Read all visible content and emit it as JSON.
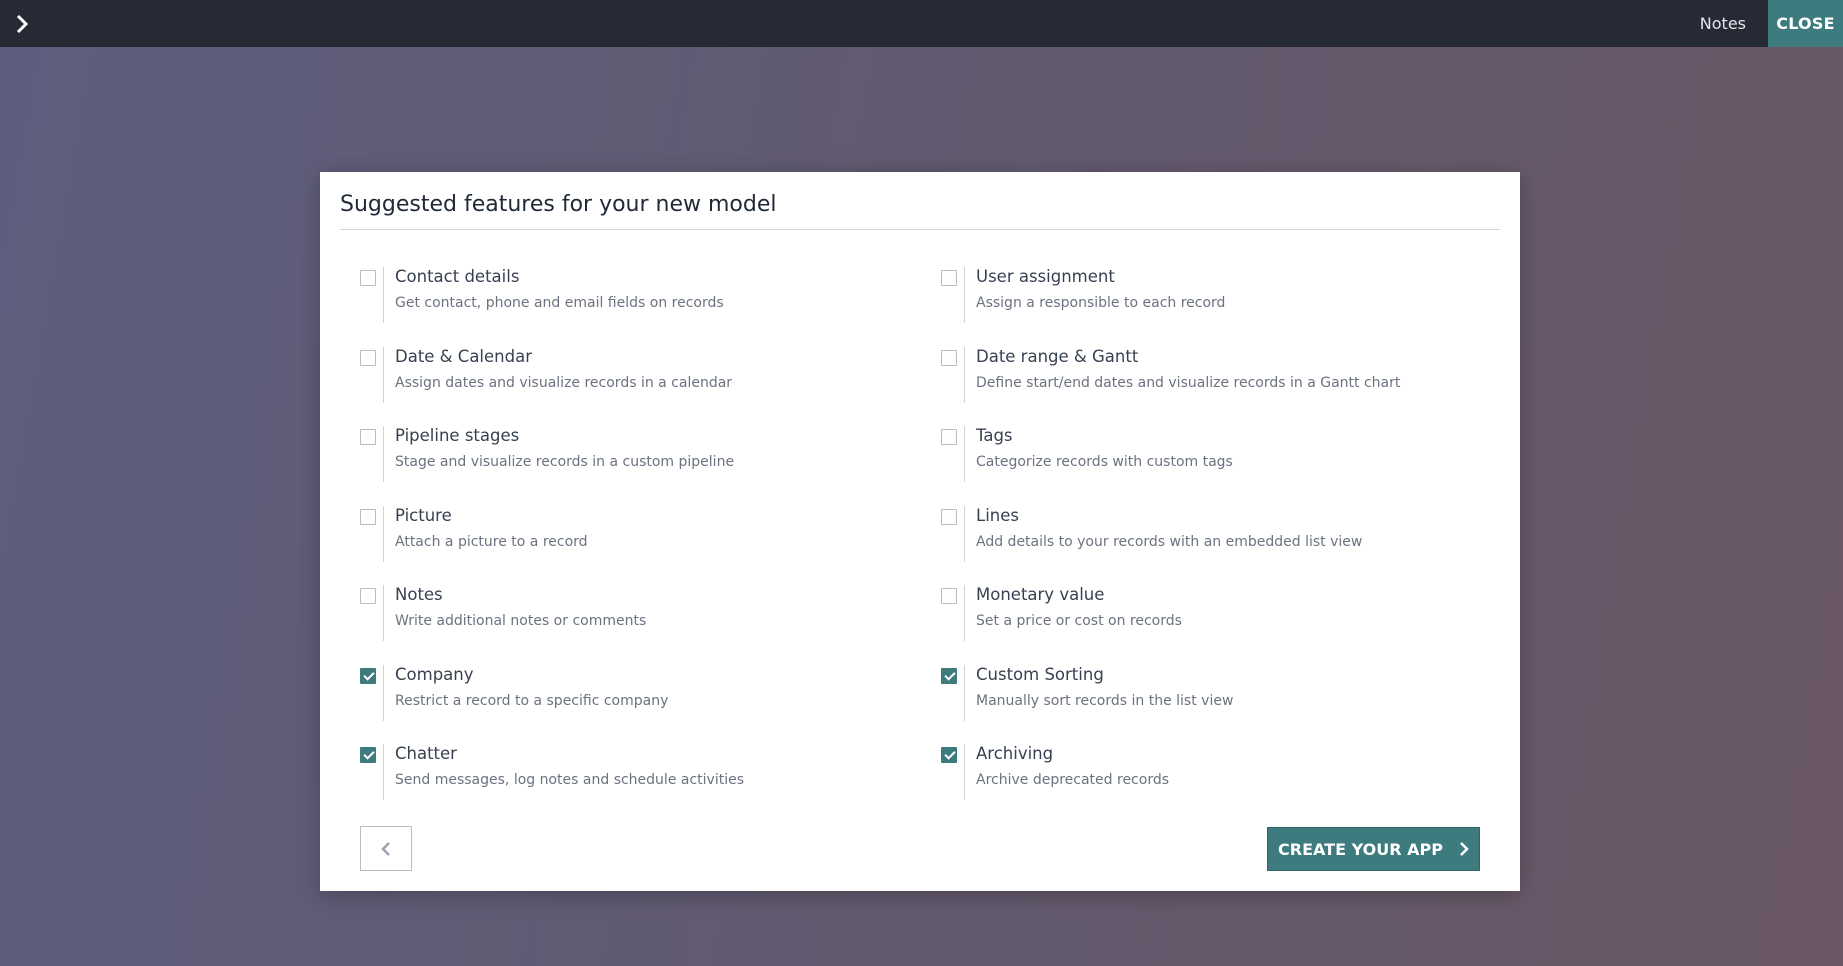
{
  "topbar": {
    "toggle_icon": "chevron-right-icon",
    "notes_label": "Notes",
    "close_label": "CLOSE"
  },
  "modal": {
    "title": "Suggested features for your new model",
    "features": [
      {
        "title": "Contact details",
        "desc": "Get contact, phone and email fields on records",
        "checked": false
      },
      {
        "title": "User assignment",
        "desc": "Assign a responsible to each record",
        "checked": false
      },
      {
        "title": "Date & Calendar",
        "desc": "Assign dates and visualize records in a calendar",
        "checked": false
      },
      {
        "title": "Date range & Gantt",
        "desc": "Define start/end dates and visualize records in a Gantt chart",
        "checked": false
      },
      {
        "title": "Pipeline stages",
        "desc": "Stage and visualize records in a custom pipeline",
        "checked": false
      },
      {
        "title": "Tags",
        "desc": "Categorize records with custom tags",
        "checked": false
      },
      {
        "title": "Picture",
        "desc": "Attach a picture to a record",
        "checked": false
      },
      {
        "title": "Lines",
        "desc": "Add details to your records with an embedded list view",
        "checked": false
      },
      {
        "title": "Notes",
        "desc": "Write additional notes or comments",
        "checked": false
      },
      {
        "title": "Monetary value",
        "desc": "Set a price or cost on records",
        "checked": false
      },
      {
        "title": "Company",
        "desc": "Restrict a record to a specific company",
        "checked": true
      },
      {
        "title": "Custom Sorting",
        "desc": "Manually sort records in the list view",
        "checked": true
      },
      {
        "title": "Chatter",
        "desc": "Send messages, log notes and schedule activities",
        "checked": true
      },
      {
        "title": "Archiving",
        "desc": "Archive deprecated records",
        "checked": true
      }
    ],
    "back_icon": "chevron-left-icon",
    "create_label": "CREATE YOUR APP",
    "create_icon": "chevron-right-icon"
  },
  "colors": {
    "accent": "#3d7b7f",
    "topbar_bg": "#262a35",
    "title_text": "#1f2937",
    "desc_text": "#6b7280"
  }
}
